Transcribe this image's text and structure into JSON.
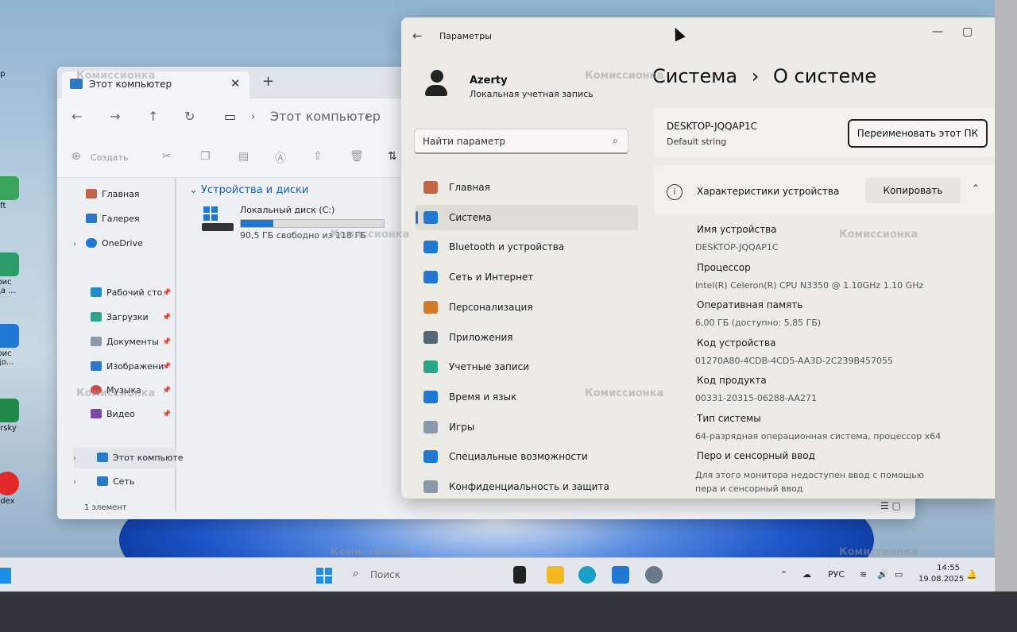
{
  "desktop": {
    "icon_labels": [
      "ер",
      "а",
      "oft",
      "фис да ...",
      "фис До...",
      "ersky",
      "ndex"
    ]
  },
  "explorer": {
    "tab_title": "Этот компьютер",
    "close": "✕",
    "new_tab": "+",
    "nav": {
      "back": "←",
      "forward": "→",
      "up": "↑",
      "refresh": "↻"
    },
    "address": "Этот компьютер",
    "toolbar": {
      "create": "Создать"
    },
    "sidebar": {
      "home": "Главная",
      "gallery": "Галерея",
      "onedrive": "OneDrive",
      "pinned": [
        "Рабочий сто",
        "Загрузки",
        "Документы",
        "Изображени",
        "Музыка",
        "Видео"
      ],
      "this_pc": "Этот компьюте",
      "network": "Сеть"
    },
    "group_title": "Устройства и диски",
    "drive": {
      "name": "Локальный диск (C:)",
      "free": "90,5 ГБ свободно из 118 ГБ",
      "used_fraction": 0.23
    },
    "status": "1 элемент"
  },
  "settings": {
    "title": "Параметры",
    "user": {
      "name": "Azerty",
      "account": "Локальная учетная запись"
    },
    "search_placeholder": "Найти параметр",
    "nav": [
      {
        "label": "Главная",
        "icon": "home-icon",
        "color": "#c0674a"
      },
      {
        "label": "Система",
        "icon": "system-icon",
        "color": "#1f78d1"
      },
      {
        "label": "Bluetooth и устройства",
        "icon": "bluetooth-icon",
        "color": "#1f78d1"
      },
      {
        "label": "Сеть и Интернет",
        "icon": "network-icon",
        "color": "#1f78d1"
      },
      {
        "label": "Персонализация",
        "icon": "brush-icon",
        "color": "#d07a2a"
      },
      {
        "label": "Приложения",
        "icon": "apps-icon",
        "color": "#556677"
      },
      {
        "label": "Учетные записи",
        "icon": "accounts-icon",
        "color": "#2aa58a"
      },
      {
        "label": "Время и язык",
        "icon": "globe-icon",
        "color": "#1f78d1"
      },
      {
        "label": "Игры",
        "icon": "gamepad-icon",
        "color": "#8a9aab"
      },
      {
        "label": "Специальные возможности",
        "icon": "accessibility-icon",
        "color": "#1f78d1"
      },
      {
        "label": "Конфиденциальность и защита",
        "icon": "shield-icon",
        "color": "#8a9aab"
      }
    ],
    "breadcrumb": {
      "parent": "Система",
      "sep": "›",
      "current": "О системе"
    },
    "device": {
      "name": "DESKTOP-JQQAP1C",
      "sub": "Default string",
      "rename": "Переименовать этот ПК"
    },
    "specs": {
      "title": "Характеристики устройства",
      "copy": "Копировать",
      "rows": [
        {
          "label": "Имя устройства",
          "value": "DESKTOP-JQQAP1C"
        },
        {
          "label": "Процессор",
          "value": "Intel(R) Celeron(R) CPU N3350 @ 1.10GHz   1.10 GHz"
        },
        {
          "label": "Оперативная память",
          "value": "6,00 ГБ (доступно: 5,85 ГБ)"
        },
        {
          "label": "Код устройства",
          "value": "01270A80-4CDB-4CD5-AA3D-2C239B457055"
        },
        {
          "label": "Код продукта",
          "value": "00331-20315-06288-AA271"
        },
        {
          "label": "Тип системы",
          "value": "64-разрядная операционная система, процессор x64"
        },
        {
          "label": "Перо и сенсорный ввод",
          "value": "Для этого монитора недоступен ввод с помощью пера и сенсорный ввод"
        }
      ]
    }
  },
  "watermark": "Комиссионка",
  "taskbar": {
    "search": "Поиск",
    "lang": "РУС",
    "time": "14:55",
    "date": "19.08.2025"
  }
}
